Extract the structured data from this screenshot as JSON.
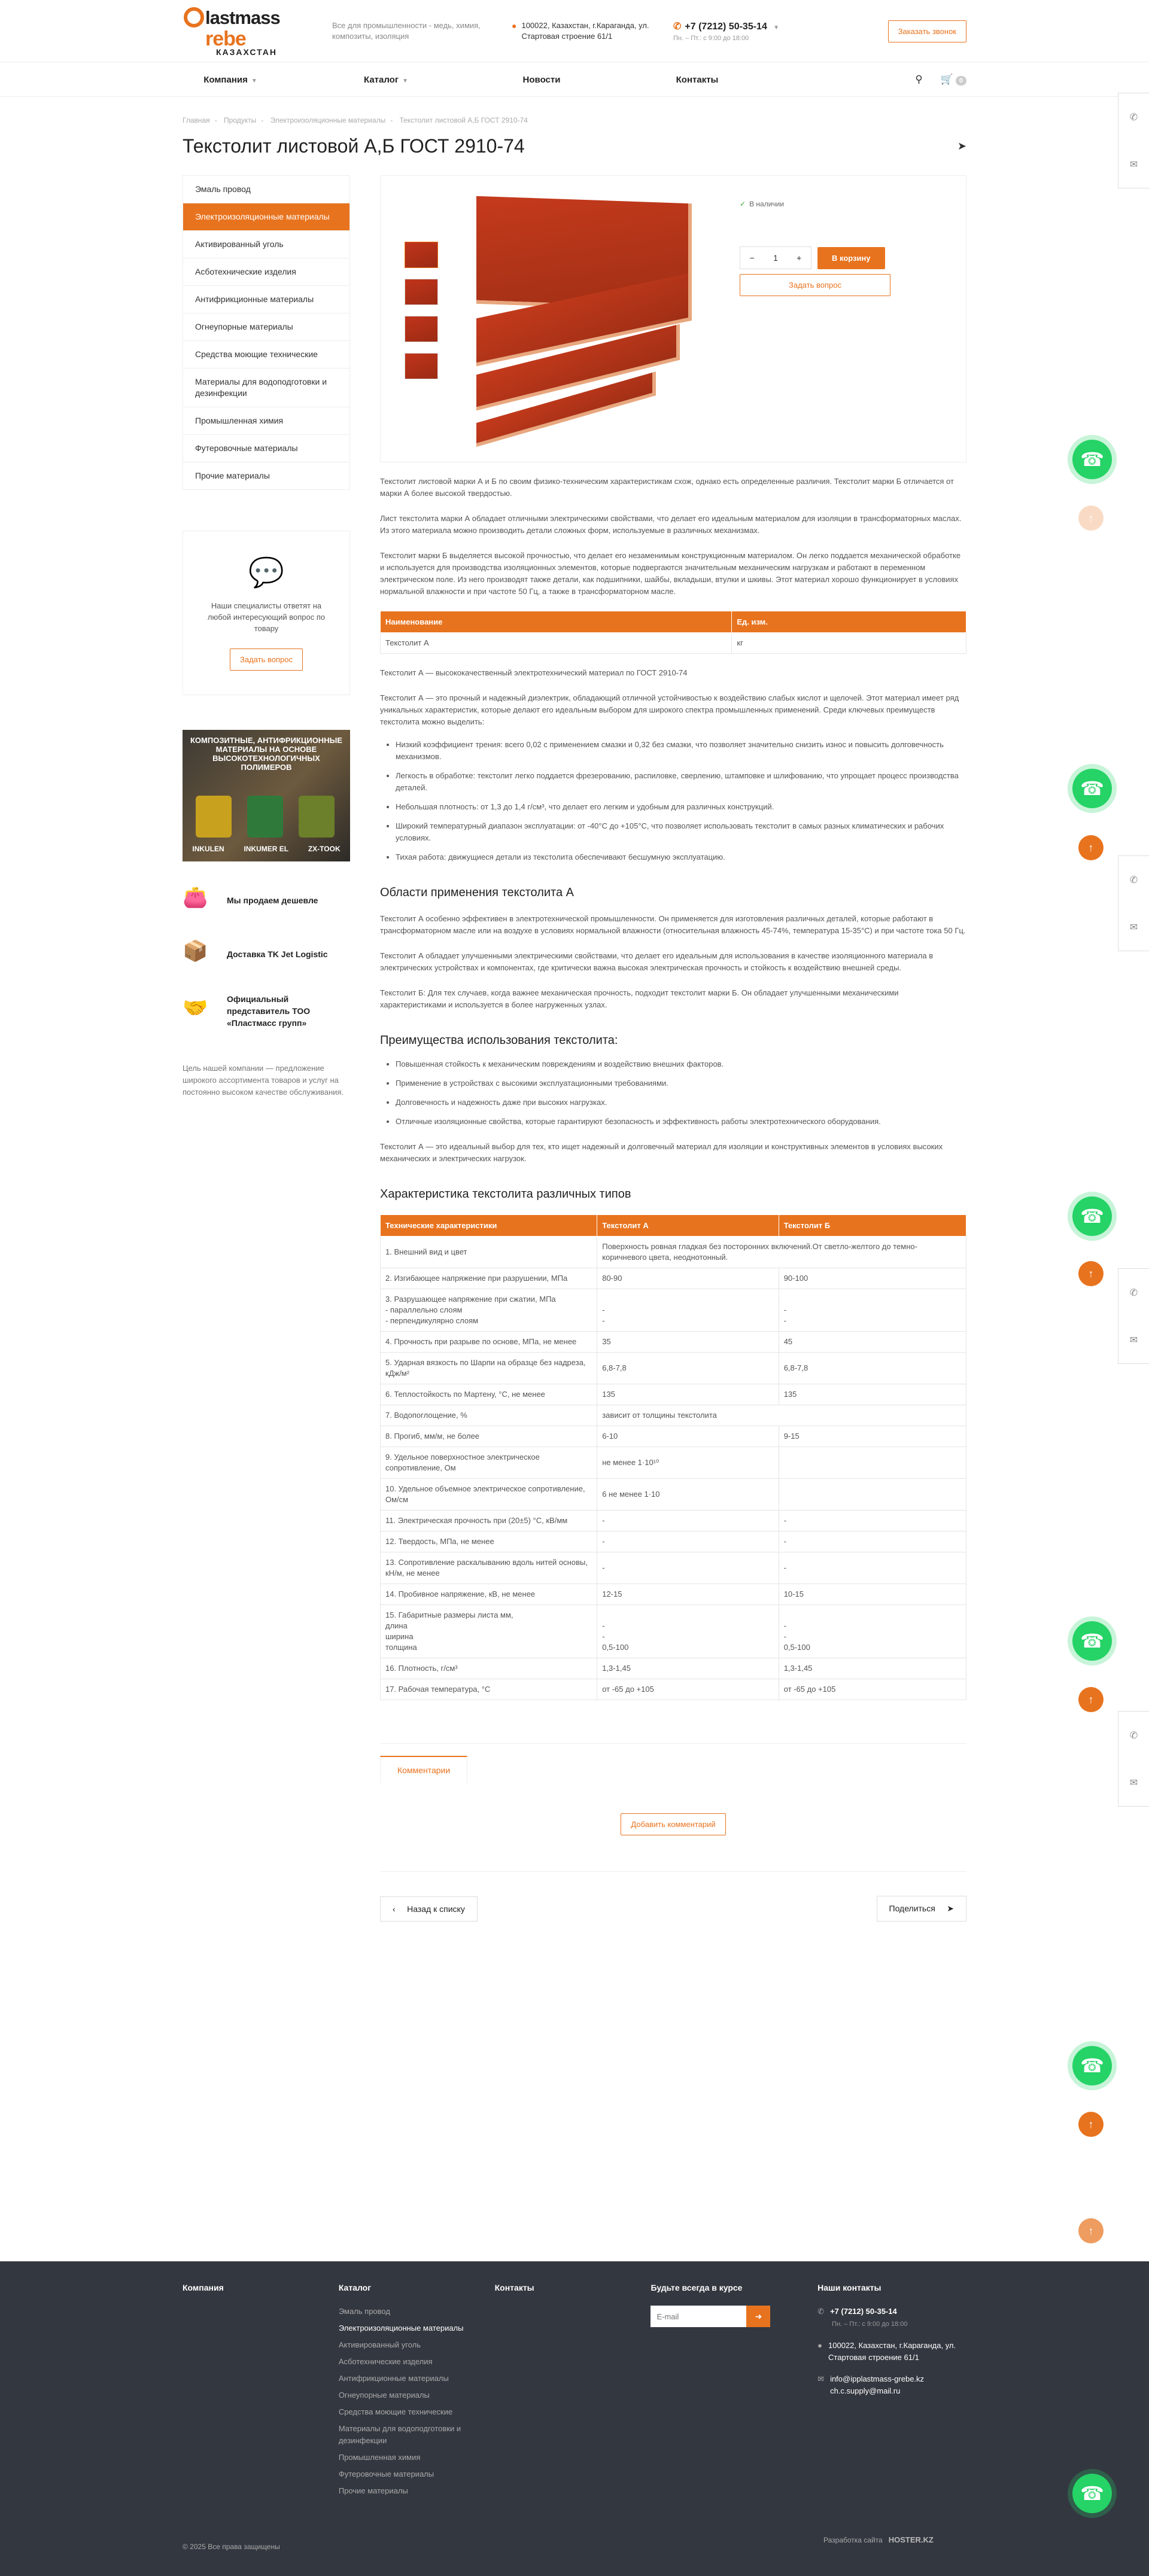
{
  "header": {
    "logo": {
      "line1": "lastmass",
      "line2": "rebe",
      "line3": "КАЗАХСТАН"
    },
    "slogan": "Все для промышленности - медь, химия, композиты, изоляция",
    "address": "100022, Казахстан, г.Караганда, ул. Стартовая строение 61/1",
    "phone": "+7 (7212) 50-35-14",
    "hours": "Пн. – Пт.: с 9:00 до 18:00",
    "callback_label": "Заказать звонок"
  },
  "nav": {
    "items": [
      {
        "label": "Компания",
        "has_dropdown": true
      },
      {
        "label": "Каталог",
        "has_dropdown": true
      },
      {
        "label": "Новости",
        "has_dropdown": false
      },
      {
        "label": "Контакты",
        "has_dropdown": false
      }
    ],
    "cart_count": "0"
  },
  "breadcrumbs": [
    "Главная",
    "Продукты",
    "Электроизоляционные материалы",
    "Текстолит листовой А,Б ГОСТ 2910-74"
  ],
  "page_title": "Текстолит листовой А,Б ГОСТ 2910-74",
  "sidebar": {
    "items": [
      {
        "label": "Эмаль провод",
        "active": false
      },
      {
        "label": "Электроизоляционные материалы",
        "active": true
      },
      {
        "label": "Активированный уголь",
        "active": false
      },
      {
        "label": "Асботехнические изделия",
        "active": false
      },
      {
        "label": "Антифрикционные материалы",
        "active": false
      },
      {
        "label": "Огнеупорные материалы",
        "active": false
      },
      {
        "label": "Средства моющие технические",
        "active": false
      },
      {
        "label": "Материалы для водоподготовки и дезинфекции",
        "active": false
      },
      {
        "label": "Промышленная химия",
        "active": false
      },
      {
        "label": "Футеровочные материалы",
        "active": false
      },
      {
        "label": "Прочие материалы",
        "active": false
      }
    ],
    "ask_text": "Наши специалисты ответят на любой интересующий вопрос по товару",
    "ask_button": "Задать вопрос",
    "banner": {
      "title": "КОМПОЗИТНЫЕ, АНТИФРИКЦИОННЫЕ МАТЕРИАЛЫ НА ОСНОВЕ ВЫСОКОТЕХНОЛОГИЧНЫХ ПОЛИМЕРОВ",
      "labels": [
        "INKULEN",
        "INKUMER EL",
        "ZX-TOOK"
      ]
    },
    "features": [
      {
        "icon": "wallet-icon",
        "text": "Мы продаем дешевле"
      },
      {
        "icon": "delivery-box-icon",
        "text": "Доставка TK Jet Logistic"
      },
      {
        "icon": "handshake-icon",
        "text": "Официальный представитель ТОО «Пластмасс групп»"
      }
    ],
    "note": "Цель нашей компании — предложение широкого ассортимента товаров и услуг на постоянно высоком качестве обслуживания."
  },
  "product": {
    "stock": "В наличии",
    "qty": "1",
    "cart_label": "В корзину",
    "ask_label": "Задать вопрос"
  },
  "desc": {
    "p1": "Текстолит листовой марки А и Б по своим физико-техническим характеристикам схож, однако есть определенные различия. Текстолит марки Б отличается от марки А более высокой твердостью.",
    "p2": "Лист текстолита марки А обладает отличными электрическими свойствами, что делает его идеальным материалом для изоляции в трансформаторных маслах. Из этого материала можно производить детали сложных форм, используемые в различных механизмах.",
    "p3": "Текстолит марки Б выделяется высокой прочностью, что делает его незаменимым конструкционным материалом. Он легко поддается механической обработке и используется для производства изоляционных элементов, которые подвергаются значительным механическим нагрузкам и работают в переменном электрическом поле. Из него производят также детали, как подшипники, шайбы, вкладыши, втулки и шкивы. Этот материал хорошо функционирует в условиях нормальной влажности и при частоте 50 Гц, а также в трансформаторном масле.",
    "small_table": {
      "headers": [
        "Наименование",
        "Ед. изм."
      ],
      "rows": [
        [
          "Текстолит А",
          "кг"
        ]
      ]
    },
    "p4": "Текстолит А — высококачественный электротехнический материал по ГОСТ 2910-74",
    "p5": "Текстолит А — это прочный и надежный диэлектрик, обладающий отличной устойчивостью к воздействию слабых кислот и щелочей. Этот материал имеет ряд уникальных характеристик, которые делают его идеальным выбором для широкого спектра промышленных применений. Среди ключевых преимуществ текстолита можно выделить:",
    "list1": [
      "Низкий коэффициент трения: всего 0,02 с применением смазки и 0,32 без смазки, что позволяет значительно снизить износ и повысить долговечность механизмов.",
      "Легкость в обработке: текстолит легко поддается фрезерованию, распиловке, сверлению, штамповке и шлифованию, что упрощает процесс производства деталей.",
      "Небольшая плотность: от 1,3 до 1,4 г/см³, что делает его легким и удобным для различных конструкций.",
      "Широкий температурный диапазон эксплуатации: от -40°С до +105°С, что позволяет использовать текстолит в самых разных климатических и рабочих условиях.",
      "Тихая работа: движущиеся детали из текстолита обеспечивают бесшумную эксплуатацию."
    ],
    "h2_1": "Области применения текстолита А",
    "p6": "Текстолит А особенно эффективен в электротехнической промышленности. Он применяется для изготовления различных деталей, которые работают в трансформаторном масле или на воздухе в условиях нормальной влажности (относительная влажность 45-74%, температура 15-35°С) и при частоте тока 50 Гц.",
    "p7": "Текстолит А обладает улучшенными электрическими свойствами, что делает его идеальным для использования в качестве изоляционного материала в электрических устройствах и компонентах, где критически важна высокая электрическая прочность и стойкость к воздействию внешней среды.",
    "p8": "Текстолит Б: Для тех случаев, когда важнее механическая прочность, подходит текстолит марки Б. Он обладает улучшенными механическими характеристиками и используется в более нагруженных узлах.",
    "h2_2": "Преимущества использования текстолита:",
    "list2": [
      "Повышенная стойкость к механическим повреждениям и воздействию внешних факторов.",
      "Применение в устройствах с высокими эксплуатационными требованиями.",
      "Долговечность и надежность даже при высоких нагрузках.",
      "Отличные изоляционные свойства, которые гарантируют безопасность и эффективность работы электротехнического оборудования."
    ],
    "p9": "Текстолит А — это идеальный выбор для тех, кто ищет надежный и долговечный материал для изоляции и конструктивных элементов в условиях высоких механических и электрических нагрузок.",
    "h2_3": "Характеристика текстолита различных типов",
    "big_table": {
      "headers": [
        "Технические характеристики",
        "Текстолит А",
        "Текстолит Б"
      ],
      "rows": [
        [
          "1. Внешний вид и цвет",
          "Поверхность ровная гладкая без посторонних включений.От светло-желтого до темно-коричневого цвета, неоднотонный.",
          ""
        ],
        [
          "2. Изгибающее напряжение при разрушении, МПа",
          "80-90",
          "90-100"
        ],
        [
          "3. Разрушающее напряжение при сжатии, МПа\n- параллельно слоям\n- перпендикулярно слоям",
          "\n-\n-",
          "\n-\n-"
        ],
        [
          "4. Прочность при разрыве по основе, МПа, не менее",
          "35",
          "45"
        ],
        [
          "5. Ударная вязкость по Шарпи на образце без надреза, кДж/м²",
          "6,8-7,8",
          "6,8-7,8"
        ],
        [
          "6. Теплостойкость по Мартену, °С, не менее",
          "135",
          "135"
        ],
        [
          "7. Водопоглощение, %",
          "зависит от толщины текстолита",
          ""
        ],
        [
          "8. Прогиб, мм/м, не более",
          "6-10",
          "9-15"
        ],
        [
          "9. Удельное поверхностное электрическое сопротивление, Ом",
          "не менее 1·10¹⁰",
          ""
        ],
        [
          "10. Удельное объемное электрическое сопротивление, Ом/см",
          "6 не менее 1·10",
          ""
        ],
        [
          "11. Электрическая прочность при (20±5) °С, кВ/мм",
          "-",
          "-"
        ],
        [
          "12. Твердость, МПа, не менее",
          "-",
          "-"
        ],
        [
          "13. Сопротивление раскалыванию вдоль нитей основы, кН/м, не менее",
          "-",
          "-"
        ],
        [
          "14. Пробивное напряжение, кВ, не менее",
          "12-15",
          "10-15"
        ],
        [
          "15. Габаритные размеры листа мм,\nдлина\nширина\nтолщина",
          "\n-\n-\n0,5-100",
          "\n-\n-\n0,5-100"
        ],
        [
          "16. Плотность, г/см³",
          "1,3-1,45",
          "1,3-1,45"
        ],
        [
          "17. Рабочая температура, °С",
          "от -65 до +105",
          "от -65 до +105"
        ]
      ]
    }
  },
  "comments": {
    "tab": "Комментарии",
    "add": "Добавить комментарий"
  },
  "bottom_nav": {
    "back": "Назад к списку",
    "share": "Поделиться"
  },
  "footer": {
    "col1_title": "Компания",
    "col2_title": "Каталог",
    "col2_items": [
      "Эмаль провод",
      "Электроизоляционные материалы",
      "Активированный уголь",
      "Асботехнические изделия",
      "Антифрикционные материалы",
      "Огнеупорные материалы",
      "Средства моющие технические",
      "Материалы для водоподготовки и дезинфекции",
      "Промышленная химия",
      "Футеровочные материалы",
      "Прочие материалы"
    ],
    "col3_title": "Контакты",
    "col4_title": "Будьте всегда в курсе",
    "email_placeholder": "E-mail",
    "col5_title": "Наши контакты",
    "phone": "+7 (7212) 50-35-14",
    "hours": "Пн. – Пт.: с 9:00 до 18:00",
    "address": "100022, Казахстан, г.Караганда, ул. Стартовая строение 61/1",
    "emails": "info@ipplastmass-grebe.kz ch.c.supply@mail.ru",
    "copyright": "© 2025 Все права защищены",
    "dev": "Разработка сайта",
    "dev_logo": "HOSTER.KZ"
  },
  "colors": {
    "accent": "#e8731e",
    "footer_bg": "#333740",
    "whatsapp": "#25d366"
  }
}
